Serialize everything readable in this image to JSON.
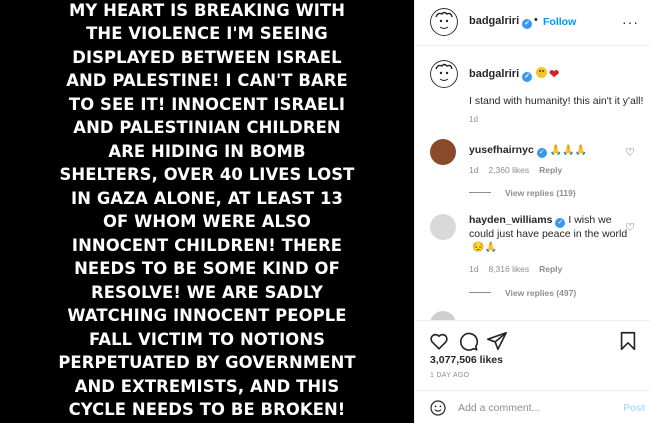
{
  "post": {
    "image_text": "MY HEART IS BREAKING WITH THE VIOLENCE I'M SEEING DISPLAYED BETWEEN ISRAEL AND PALESTINE! I CAN'T BARE TO SEE IT! INNOCENT ISRAELI AND PALESTINIAN CHILDREN ARE HIDING IN BOMB SHELTERS, OVER 40 LIVES LOST IN GAZA ALONE, AT LEAST 13 OF WHOM WERE ALSO INNOCENT CHILDREN! THERE NEEDS TO BE SOME KIND OF RESOLVE! WE ARE SADLY WATCHING INNOCENT PEOPLE FALL VICTIM TO NOTIONS PERPETUATED BY GOVERNMENT AND EXTREMISTS, AND THIS CYCLE NEEDS TO BE BROKEN!"
  },
  "header": {
    "username": "badgalriri",
    "dot": "•",
    "follow_label": "Follow",
    "more_label": "···"
  },
  "caption": {
    "username": "badgalriri",
    "text": "I stand with humanity! this ain't it y'all!",
    "time": "1d"
  },
  "comments": [
    {
      "username": "yusefhairnyc",
      "text": "",
      "emoji": "🙏🙏🙏",
      "time": "1d",
      "likes": "2,360 likes",
      "reply_label": "Reply",
      "view_replies": "View replies (119)"
    },
    {
      "username": "hayden_williams",
      "text": "I wish we could just have peace in the world",
      "emoji": "😔🙏",
      "time": "1d",
      "likes": "8,316 likes",
      "reply_label": "Reply",
      "view_replies": "View replies (497)"
    }
  ],
  "footer": {
    "likes_count": "3,077,506 likes",
    "time_ago": "1 DAY AGO",
    "comment_placeholder": "Add a comment...",
    "post_label": "Post"
  },
  "colors": {
    "accent": "#0095f6",
    "verified": "#3897f0",
    "muted": "#8e8e8e",
    "text": "#262626"
  }
}
